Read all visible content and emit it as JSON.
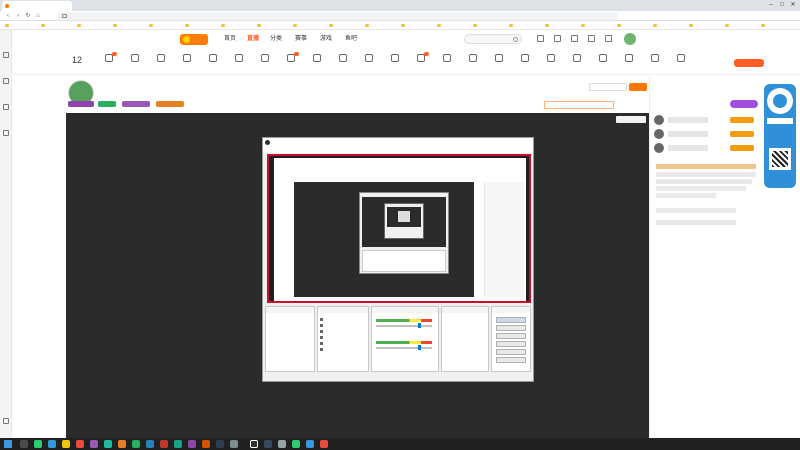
{
  "browser": {
    "tab_title": "",
    "url": "",
    "controls": {
      "minimize": "–",
      "maximize": "□",
      "close": "✕"
    },
    "nav": {
      "back": "‹",
      "forward": "›",
      "reload": "↻",
      "home": "⌂"
    }
  },
  "site_header": {
    "nav": [
      {
        "label": "首页",
        "active": false
      },
      {
        "label": "直播",
        "active": true
      },
      {
        "label": "分类",
        "active": false
      },
      {
        "label": "赛事",
        "active": false
      },
      {
        "label": "游戏",
        "active": false
      },
      {
        "label": "鱼吧",
        "active": false
      }
    ]
  },
  "user_bar": {
    "level": "12"
  },
  "room": {
    "title": "",
    "tags": [
      {
        "text": "",
        "color": "#8e44ad"
      },
      {
        "text": "",
        "color": "#27ae60"
      },
      {
        "text": "",
        "color": "#9b59b6"
      },
      {
        "text": "",
        "color": "#e67e22"
      }
    ]
  },
  "player": {
    "corner_button": ""
  },
  "obs": {
    "title": "",
    "menu": ""
  },
  "right_panel": {
    "tabs": ""
  },
  "taskbar": {
    "time": "",
    "date": ""
  },
  "colors": {
    "accent": "#ff5d23",
    "obs_border": "#c8102e",
    "ad_blue": "#2f8fd8",
    "purple": "#a14fe0"
  }
}
